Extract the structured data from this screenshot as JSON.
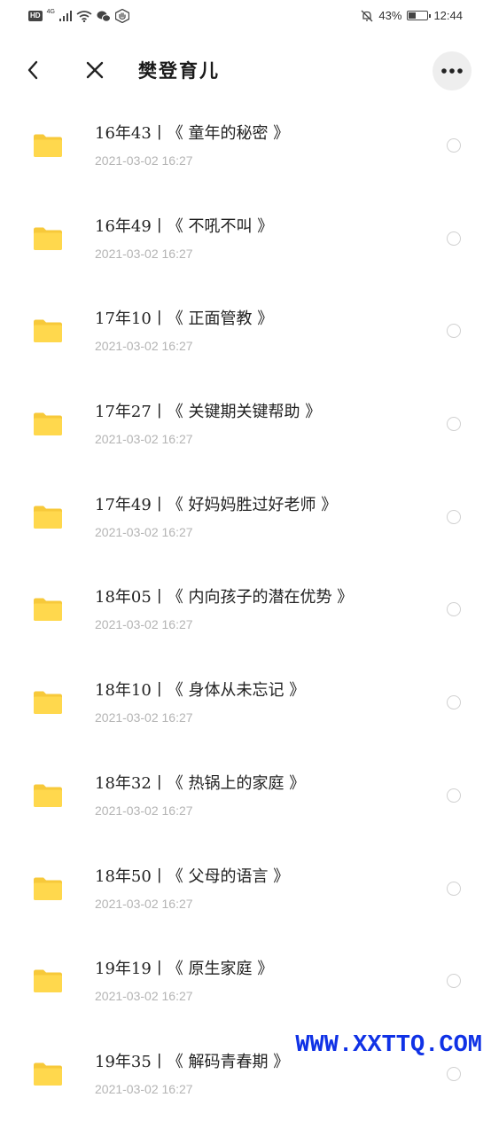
{
  "statusbar": {
    "network": "4G",
    "battery_percent": "43%",
    "battery_level": 0.43,
    "time": "12:44"
  },
  "header": {
    "title": "樊登育儿"
  },
  "items": [
    {
      "name": "16年43丨《 童年的秘密 》",
      "date": "2021-03-02 16:27"
    },
    {
      "name": "16年49丨《 不吼不叫 》",
      "date": "2021-03-02 16:27"
    },
    {
      "name": "17年10丨《 正面管教 》",
      "date": "2021-03-02 16:27"
    },
    {
      "name": "17年27丨《 关键期关键帮助 》",
      "date": "2021-03-02 16:27"
    },
    {
      "name": "17年49丨《 好妈妈胜过好老师 》",
      "date": "2021-03-02 16:27"
    },
    {
      "name": "18年05丨《 内向孩子的潜在优势 》",
      "date": "2021-03-02 16:27"
    },
    {
      "name": "18年10丨《 身体从未忘记 》",
      "date": "2021-03-02 16:27"
    },
    {
      "name": "18年32丨《 热锅上的家庭 》",
      "date": "2021-03-02 16:27"
    },
    {
      "name": "18年50丨《 父母的语言 》",
      "date": "2021-03-02 16:27"
    },
    {
      "name": "19年19丨《 原生家庭 》",
      "date": "2021-03-02 16:27"
    },
    {
      "name": "19年35丨《 解码青春期 》",
      "date": "2021-03-02 16:27"
    }
  ],
  "watermark": "WWW.XXTTQ.COM",
  "colors": {
    "folder": "#FFD84D",
    "folder_tab": "#F7C93A",
    "date_text": "#B4B4B4",
    "watermark": "#1032E6"
  }
}
